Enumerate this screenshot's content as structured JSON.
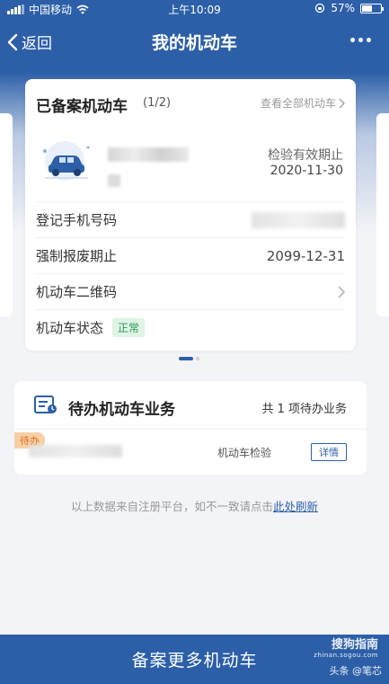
{
  "status_bar": {
    "carrier": "中国移动",
    "time": "上午10:09",
    "battery": "57%",
    "battery_level": 0.57
  },
  "nav": {
    "back_label": "返回",
    "title": "我的机动车"
  },
  "vehicle_card": {
    "title": "已备案机动车",
    "count": "(1/2)",
    "view_all": "查看全部机动车",
    "inspection_label": "检验有效期止",
    "inspection_date": "2020-11-30",
    "rows": [
      {
        "label": "登记手机号码",
        "value": ""
      },
      {
        "label": "强制报废期止",
        "value": "2099-12-31"
      },
      {
        "label": "机动车二维码",
        "value": ""
      },
      {
        "label": "机动车状态",
        "value": "正常"
      }
    ]
  },
  "pending_card": {
    "title": "待办机动车业务",
    "count_text": "共 1 项待办业务",
    "tag": "待办",
    "business_type": "机动车检验",
    "details_button": "详情"
  },
  "note": {
    "text": "以上数据来自注册平台，如不一致请点击",
    "link": "此处刷新"
  },
  "bottom_button": "备案更多机动车",
  "watermark": {
    "brand": "搜狗指南",
    "domain": "zhinan.sogou.com",
    "author": "头条 @笔芯"
  },
  "colors": {
    "primary": "#2c5fa8",
    "success": "#2f9b5a",
    "pending": "#e0731c"
  }
}
